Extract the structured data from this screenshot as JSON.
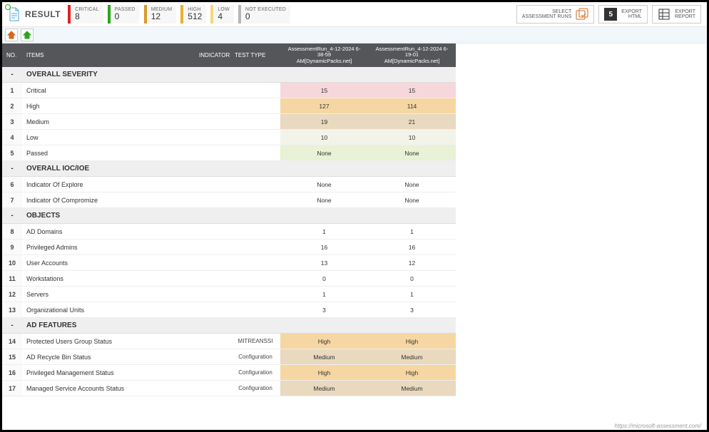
{
  "header": {
    "resultLabel": "RESULT",
    "stats": {
      "critical": {
        "label": "CRITICAL",
        "value": "8"
      },
      "passed": {
        "label": "PASSED",
        "value": "0"
      },
      "medium": {
        "label": "MEDIUM",
        "value": "12"
      },
      "high": {
        "label": "HIGH",
        "value": "512"
      },
      "low": {
        "label": "LOW",
        "value": "4"
      },
      "notexec": {
        "label": "NOT EXECUTED",
        "value": "0"
      }
    },
    "actions": {
      "select": {
        "line1": "SELECT",
        "line2": "ASSESSMENT RUNS"
      },
      "html": {
        "line1": "EXPORT",
        "line2": "HTML",
        "badge": "5"
      },
      "report": {
        "line1": "EXPORT",
        "line2": "REPORT"
      }
    }
  },
  "columns": {
    "no": "NO.",
    "items": "ITEMS",
    "indicator": "INDICATOR",
    "testtype": "TEST TYPE",
    "run1": {
      "l1": "AssessmentRun_4-12-2024 6-38-59",
      "l2": "AM[DynamicPacks.net]"
    },
    "run2": {
      "l1": "AssessmentRun_4-12-2024 6-19-01",
      "l2": "AM[DynamicPacks.net]"
    }
  },
  "severityColors": {
    "Critical": "cell-critical",
    "High": "cell-high",
    "Medium": "cell-medium",
    "Low": "cell-low",
    "Passed": "cell-passed"
  },
  "rows": [
    {
      "type": "section",
      "no": "-",
      "item": "OVERALL SEVERITY"
    },
    {
      "type": "severityrow",
      "no": "1",
      "item": "Critical",
      "v1": "15",
      "v2": "15",
      "cls": "cell-critical"
    },
    {
      "type": "severityrow",
      "no": "2",
      "item": "High",
      "v1": "127",
      "v2": "114",
      "cls": "cell-high"
    },
    {
      "type": "severityrow",
      "no": "3",
      "item": "Medium",
      "v1": "19",
      "v2": "21",
      "cls": "cell-medium"
    },
    {
      "type": "severityrow",
      "no": "4",
      "item": "Low",
      "v1": "10",
      "v2": "10",
      "cls": "cell-low"
    },
    {
      "type": "severityrow",
      "no": "5",
      "item": "Passed",
      "v1": "None",
      "v2": "None",
      "cls": "cell-passed"
    },
    {
      "type": "section",
      "no": "-",
      "item": "OVERALL IOC/IOE"
    },
    {
      "type": "plain",
      "no": "6",
      "item": "Indicator Of Explore",
      "v1": "None",
      "v2": "None"
    },
    {
      "type": "plain",
      "no": "7",
      "item": "Indicator Of Compromize",
      "v1": "None",
      "v2": "None"
    },
    {
      "type": "section",
      "no": "-",
      "item": "OBJECTS"
    },
    {
      "type": "plain",
      "no": "8",
      "item": "AD Domains",
      "v1": "1",
      "v2": "1"
    },
    {
      "type": "plain",
      "no": "9",
      "item": "Privileged Admins",
      "v1": "16",
      "v2": "16"
    },
    {
      "type": "plain",
      "no": "10",
      "item": "User Accounts",
      "v1": "13",
      "v2": "12"
    },
    {
      "type": "plain",
      "no": "11",
      "item": "Workstations",
      "v1": "0",
      "v2": "0"
    },
    {
      "type": "plain",
      "no": "12",
      "item": "Servers",
      "v1": "1",
      "v2": "1"
    },
    {
      "type": "plain",
      "no": "13",
      "item": "Organizational Units",
      "v1": "3",
      "v2": "3"
    },
    {
      "type": "section",
      "no": "-",
      "item": "AD FEATURES"
    },
    {
      "type": "feature",
      "no": "14",
      "item": "Protected Users Group Status",
      "tt": "MITREANSSI",
      "v1": "High",
      "v2": "High",
      "cls": "cell-high"
    },
    {
      "type": "feature",
      "no": "15",
      "item": "AD Recycle Bin Status",
      "tt": "Configuration",
      "v1": "Medium",
      "v2": "Medium",
      "cls": "cell-medium"
    },
    {
      "type": "feature",
      "no": "16",
      "item": "Privileged Management Status",
      "tt": "Configuration",
      "v1": "High",
      "v2": "High",
      "cls": "cell-high"
    },
    {
      "type": "feature",
      "no": "17",
      "item": "Managed Service Accounts Status",
      "tt": "Configuration",
      "v1": "Medium",
      "v2": "Medium",
      "cls": "cell-medium"
    }
  ],
  "footerUrl": "https://microsoft-assessment.com/"
}
